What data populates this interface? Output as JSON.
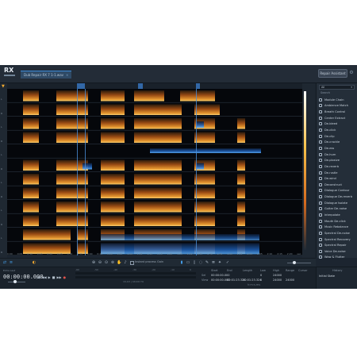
{
  "app": {
    "logo_text": "RX"
  },
  "header": {
    "tab_label": "Dub Repair RX 7 1-1.wav",
    "tab_close": "×",
    "repair_assistant": "Repair Assistant",
    "gear": "⚙"
  },
  "left_labels": [
    "L",
    "R",
    "L",
    "R",
    "L",
    "R",
    "L",
    "R",
    "L",
    "R",
    "L",
    "R"
  ],
  "modules": {
    "filter_value": "All",
    "search_value": "Search",
    "items": [
      "Module Chain",
      "Ambience Match",
      "Breath Control",
      "Center Extract",
      "De-bleed",
      "De-click",
      "De-clip",
      "De-crackle",
      "De-ess",
      "De-hum",
      "De-plosive",
      "De-reverb",
      "De-rustle",
      "De-wind",
      "Deconstruct",
      "Dialogue Contour",
      "Dialogue De-reverb",
      "Dialogue Isolate",
      "Guitar De-noise",
      "Interpolate",
      "Mouth De-click",
      "Music Rebalance",
      "Spectral De-noise",
      "Spectral Recovery",
      "Spectral Repair",
      "Voice De-noise",
      "Wow & Flutter"
    ]
  },
  "freq_scale": [
    "0:00",
    "0:05",
    "0:10",
    "0:15",
    "0:20",
    "0:25",
    "0:30",
    "0:35",
    "0:40",
    "0:45",
    "0:50",
    "0:55",
    "1:00",
    "1:05",
    "1:10",
    "1:15",
    "1:20",
    "1:25",
    "1:30",
    "1:35",
    "1:40",
    "1:45",
    "1:50",
    "1:55",
    "2:00",
    "2:05",
    "2:10",
    "2:15",
    "2:20",
    "sec"
  ],
  "toolbar": {
    "instant_process": "Instant process",
    "gain": "Gain"
  },
  "transport": {
    "label": "Extra Last",
    "timecode": "00:00:00.000",
    "buttons": [
      "|◀",
      "◀◀",
      "▶",
      "■",
      "▶▶",
      "●"
    ],
    "level_labels": [
      "-60",
      "-50",
      "-40",
      "-30",
      "-20",
      "-10",
      "0"
    ],
    "format": "16-bit | 44100 Hz"
  },
  "info": {
    "headers": [
      "Start",
      "End",
      "Length",
      "Low",
      "High",
      "Range",
      "Cursor"
    ],
    "sel_label": "Sel",
    "view_label": "View",
    "sel": [
      "00:00:00.000",
      "",
      "",
      "0",
      "24000",
      "",
      ""
    ],
    "view": [
      "00:00:00.000",
      "00:01:23.324",
      "00:01:23.324",
      "0",
      "24000",
      "24000",
      ""
    ],
    "time_format": "h:m:s.ms"
  },
  "history": {
    "title": "History",
    "initial": "Initial State"
  },
  "colors": {
    "accent": "#3b8ee0",
    "spectrogram_hot": "#f0a830",
    "spectrogram_cool": "#2f7fd6",
    "panel": "#242e39"
  }
}
